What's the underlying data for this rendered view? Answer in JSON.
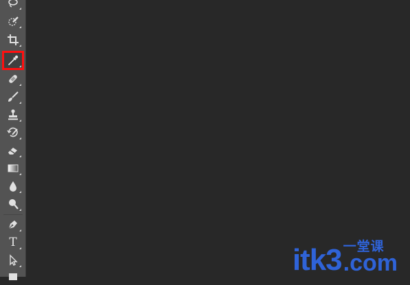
{
  "toolbar": {
    "tools": [
      {
        "name": "lasso-tool",
        "icon": "lasso-icon"
      },
      {
        "name": "quick-selection-tool",
        "icon": "quick-selection-icon"
      },
      {
        "name": "crop-tool",
        "icon": "crop-icon"
      },
      {
        "name": "eyedropper-tool",
        "icon": "eyedropper-icon",
        "selected": true
      },
      {
        "name": "spot-healing-brush-tool",
        "icon": "healing-bandage-icon"
      },
      {
        "name": "brush-tool",
        "icon": "brush-icon"
      },
      {
        "name": "clone-stamp-tool",
        "icon": "stamp-icon"
      },
      {
        "name": "history-brush-tool",
        "icon": "history-brush-icon"
      },
      {
        "name": "eraser-tool",
        "icon": "eraser-icon"
      },
      {
        "name": "gradient-tool",
        "icon": "gradient-icon"
      },
      {
        "name": "blur-tool",
        "icon": "drop-icon"
      },
      {
        "name": "dodge-tool",
        "icon": "dodge-icon"
      },
      {
        "name": "pen-tool",
        "icon": "pen-nib-icon"
      },
      {
        "name": "type-tool",
        "icon": "type-icon",
        "label": "T"
      },
      {
        "name": "path-selection-tool",
        "icon": "arrow-cursor-icon"
      },
      {
        "name": "shape-tool",
        "icon": "rectangle-icon"
      }
    ],
    "highlight_color": "#ff1010"
  },
  "watermark": {
    "main": "itk3",
    "cn": "一堂课",
    "com": ".com",
    "color": "#2f63d8"
  }
}
